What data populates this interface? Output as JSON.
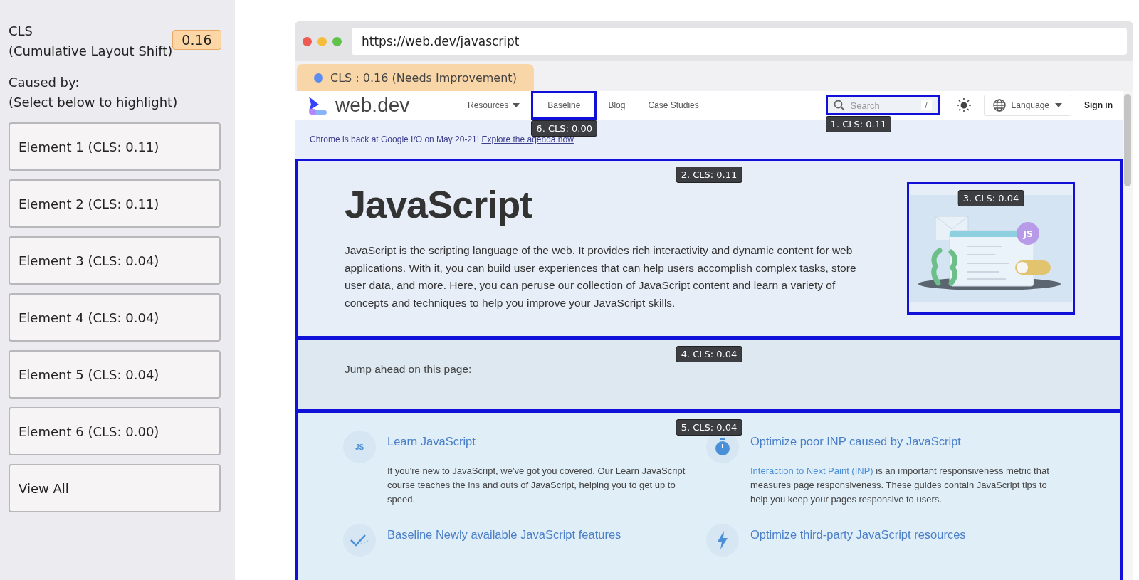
{
  "sidebar": {
    "metric": "CLS",
    "metric_full": "(Cumulative Layout Shift)",
    "score": "0.16",
    "caused_by": "Caused by:",
    "hint": "(Select below to highlight)",
    "buttons": [
      "Element 1 (CLS: 0.11)",
      "Element 2 (CLS: 0.11)",
      "Element 3 (CLS: 0.04)",
      "Element 4 (CLS: 0.04)",
      "Element 5 (CLS: 0.04)",
      "Element 6 (CLS: 0.00)",
      "View All"
    ]
  },
  "browser": {
    "url": "https://web.dev/javascript",
    "tab": "CLS : 0.16 (Needs Improvement)"
  },
  "page": {
    "logo": "web.dev",
    "nav": [
      {
        "label": "Resources",
        "dropdown": true
      },
      {
        "label": "Baseline",
        "dropdown": false,
        "highlight": "6. CLS: 0.00"
      },
      {
        "label": "Blog",
        "dropdown": false
      },
      {
        "label": "Case Studies",
        "dropdown": false
      }
    ],
    "search": {
      "placeholder": "Search",
      "shortcut": "/",
      "highlight": "1. CLS: 0.11"
    },
    "language": "Language",
    "sign_in": "Sign in",
    "banner": {
      "text": "Chrome is back at Google I/O on May 20-21! ",
      "link": "Explore the agenda now"
    },
    "hero": {
      "highlight": "2. CLS: 0.11",
      "title": "JavaScript",
      "text": "JavaScript is the scripting language of the web. It provides rich interactivity and dynamic content for web applications. With it, you can build user experiences that can help users accomplish complex tasks, store user data, and more. Here, you can peruse our collection of JavaScript content and learn a variety of concepts and techniques to help you improve your JavaScript skills.",
      "image": {
        "highlight": "3. CLS: 0.04",
        "badge": "JS"
      }
    },
    "jump": {
      "highlight": "4. CLS: 0.04",
      "text": "Jump ahead on this page:"
    },
    "cards": {
      "highlight": "5. CLS: 0.04",
      "items": [
        {
          "kind": "js",
          "icon_text": "JS",
          "title": "Learn JavaScript",
          "text": "If you're new to JavaScript, we've got you covered. Our Learn JavaScript course teaches the ins and outs of JavaScript, helping you to get up to speed."
        },
        {
          "kind": "stopwatch",
          "title": "Optimize poor INP caused by JavaScript",
          "link": "Interaction to Next Paint (INP)",
          "text": " is an important responsiveness metric that measures page responsiveness. These guides contain JavaScript tips to help you keep your pages responsive to users."
        },
        {
          "kind": "check",
          "title": "Baseline Newly available JavaScript features"
        },
        {
          "kind": "bolt",
          "title": "Optimize third-party JavaScript resources"
        }
      ]
    }
  }
}
